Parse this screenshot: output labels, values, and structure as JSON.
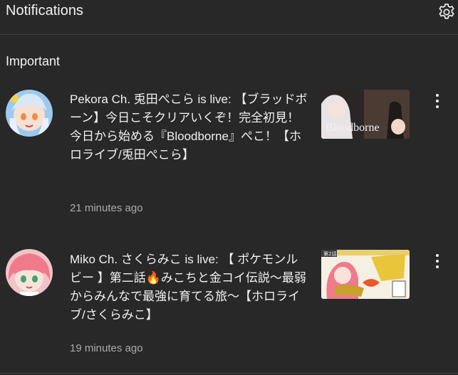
{
  "header": {
    "title": "Notifications",
    "settings_icon": "gear-icon"
  },
  "sections": [
    {
      "title": "Important",
      "notifications": [
        {
          "text": "Pekora Ch. 兎田ぺこら is live: 【ブラッドボーン】今日こそクリアいくぞ！完全初見！ 今日から始める『Bloodborne』ぺこ！【ホロライブ/兎田ぺこら】",
          "time": "21 minutes ago",
          "thumbnail_text": "Bloodborne",
          "more_icon": "more-vert-icon"
        },
        {
          "text": "Miko Ch. さくらみこ is live: 【 ポケモンルビー 】第二話🔥みこちと金コイ伝説～最弱からみんなで最強に育てる旅～【ホロライブ/さくらみこ】",
          "time": "19 minutes ago",
          "thumbnail_text": "第2話",
          "more_icon": "more-vert-icon"
        }
      ]
    }
  ],
  "colors": {
    "background": "#282828",
    "text_primary": "#f1f1f1",
    "text_secondary": "#aaaaaa",
    "divider": "#3f3f3f"
  }
}
